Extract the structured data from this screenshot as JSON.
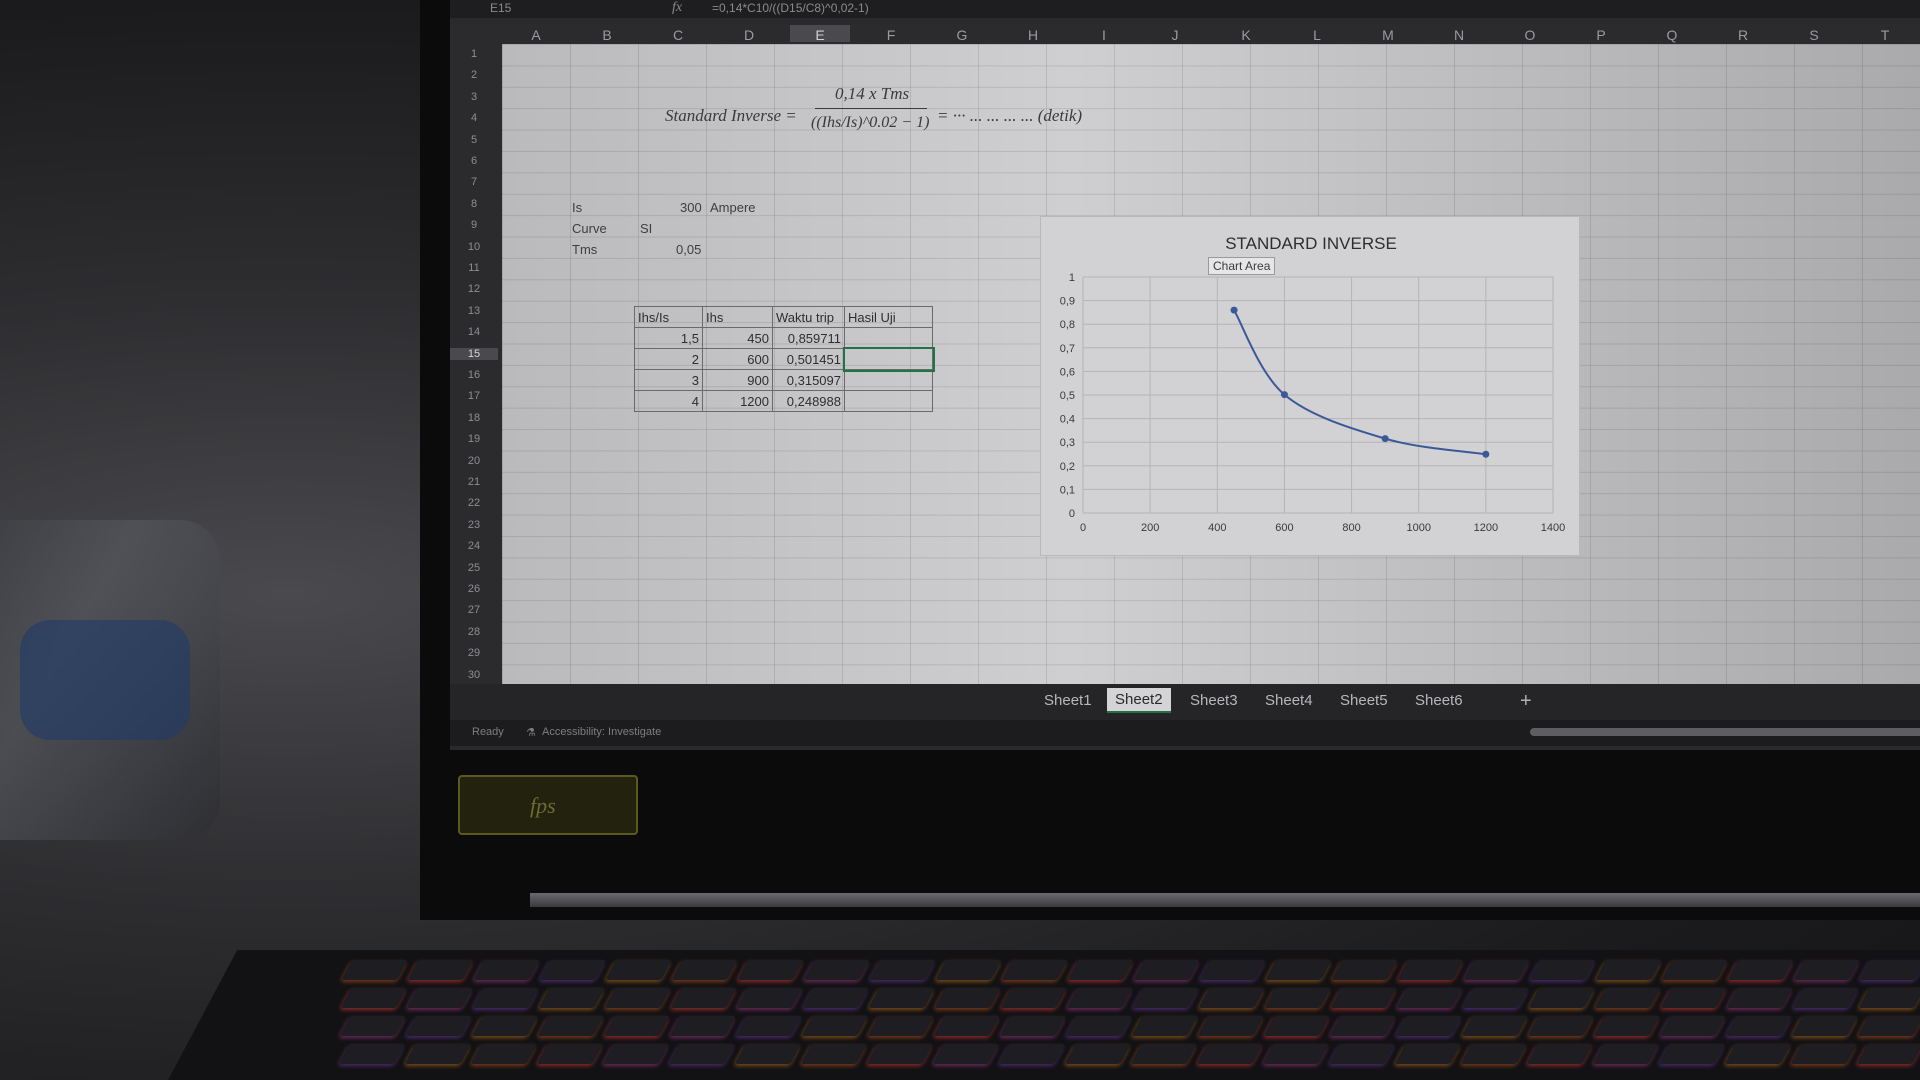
{
  "formula_bar": {
    "name_box": "E15",
    "fx": "fx",
    "formula": "=0,14*C10/((D15/C8)^0,02-1)"
  },
  "columns": [
    "A",
    "B",
    "C",
    "D",
    "E",
    "F",
    "G",
    "H",
    "I",
    "J",
    "K",
    "L",
    "M",
    "N",
    "O",
    "P",
    "Q",
    "R",
    "S",
    "T"
  ],
  "selected_column": "E",
  "rows": [
    "1",
    "2",
    "3",
    "4",
    "5",
    "6",
    "7",
    "8",
    "9",
    "10",
    "11",
    "12",
    "13",
    "14",
    "15",
    "16",
    "17",
    "18",
    "19",
    "20",
    "21",
    "22",
    "23",
    "24",
    "25",
    "26",
    "27",
    "28",
    "29",
    "30"
  ],
  "selected_row": "15",
  "formula_image": {
    "lhs": "Standard Inverse =",
    "numerator": "0,14 x Tms",
    "denominator": "((Ihs/Is)^0.02 − 1)",
    "rhs": "= ··· ... ... ... ... (detik)"
  },
  "params": {
    "is_label": "Is",
    "is_value": "300",
    "is_unit": "Ampere",
    "curve_label": "Curve",
    "curve_value": "SI",
    "tms_label": "Tms",
    "tms_value": "0,05"
  },
  "table": {
    "headers": [
      "Ihs/Is",
      "Ihs",
      "Waktu trip",
      "Hasil Uji"
    ],
    "rows": [
      [
        "1,5",
        "450",
        "0,859711",
        ""
      ],
      [
        "2",
        "600",
        "0,501451",
        ""
      ],
      [
        "3",
        "900",
        "0,315097",
        ""
      ],
      [
        "4",
        "1200",
        "0,248988",
        ""
      ]
    ]
  },
  "chart_data": {
    "type": "scatter",
    "title": "STANDARD INVERSE",
    "xlabel": "",
    "ylabel": "",
    "xlim": [
      0,
      1400
    ],
    "ylim": [
      0,
      1
    ],
    "xticks": [
      "0",
      "200",
      "400",
      "600",
      "800",
      "1000",
      "1200",
      "1400"
    ],
    "yticks": [
      "0",
      "0,1",
      "0,2",
      "0,3",
      "0,4",
      "0,5",
      "0,6",
      "0,7",
      "0,8",
      "0,9",
      "1"
    ],
    "grid": true,
    "legend": "none",
    "series": [
      {
        "x": [
          450,
          600,
          900,
          1200
        ],
        "y": [
          0.859711,
          0.501451,
          0.315097,
          0.248988
        ]
      }
    ],
    "line_color": "#3b5998"
  },
  "chart_tooltip": "Chart Area",
  "sheet_tabs": [
    "Sheet1",
    "Sheet2",
    "Sheet3",
    "Sheet4",
    "Sheet5",
    "Sheet6"
  ],
  "active_tab": "Sheet2",
  "add_sheet": "+",
  "status": {
    "ready": "Ready",
    "accessibility": "Accessibility: Investigate"
  },
  "sticker_text": "fps"
}
